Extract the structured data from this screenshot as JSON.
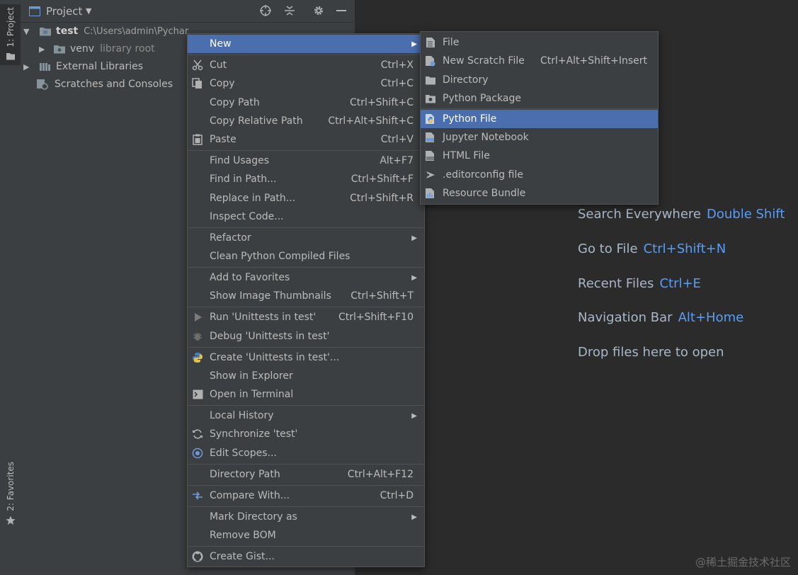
{
  "left_stripe": {
    "project_tab": "1: Project",
    "favorites_tab": "2: Favorites"
  },
  "project_panel": {
    "title": "Project",
    "tree": [
      {
        "name": "test",
        "path": "C:\\Users\\admin\\Pychar"
      },
      {
        "name": "venv",
        "tag": "library root"
      },
      {
        "name": "External Libraries"
      },
      {
        "name": "Scratches and Consoles"
      }
    ]
  },
  "editor_hints": [
    {
      "label": "Search Everywhere",
      "key": "Double Shift"
    },
    {
      "label": "Go to File",
      "key": "Ctrl+Shift+N"
    },
    {
      "label": "Recent Files",
      "key": "Ctrl+E"
    },
    {
      "label": "Navigation Bar",
      "key": "Alt+Home"
    },
    {
      "label": "Drop files here to open",
      "key": ""
    }
  ],
  "context_menu": [
    {
      "label": "New",
      "shortcut": "",
      "icon": "",
      "submenu": true,
      "selected": true
    },
    {
      "label": "Cut",
      "shortcut": "Ctrl+X",
      "icon": "scissors-icon"
    },
    {
      "label": "Copy",
      "shortcut": "Ctrl+C",
      "icon": "copy-icon"
    },
    {
      "label": "Copy Path",
      "shortcut": "Ctrl+Shift+C"
    },
    {
      "label": "Copy Relative Path",
      "shortcut": "Ctrl+Alt+Shift+C"
    },
    {
      "label": "Paste",
      "shortcut": "Ctrl+V",
      "icon": "paste-icon"
    },
    {
      "label": "Find Usages",
      "shortcut": "Alt+F7"
    },
    {
      "label": "Find in Path...",
      "shortcut": "Ctrl+Shift+F"
    },
    {
      "label": "Replace in Path...",
      "shortcut": "Ctrl+Shift+R"
    },
    {
      "label": "Inspect Code..."
    },
    {
      "label": "Refactor",
      "submenu": true
    },
    {
      "label": "Clean Python Compiled Files"
    },
    {
      "label": "Add to Favorites",
      "submenu": true
    },
    {
      "label": "Show Image Thumbnails",
      "shortcut": "Ctrl+Shift+T"
    },
    {
      "label": "Run 'Unittests in test'",
      "shortcut": "Ctrl+Shift+F10",
      "icon": "run-icon"
    },
    {
      "label": "Debug 'Unittests in test'",
      "icon": "debug-icon"
    },
    {
      "label": "Create 'Unittests in test'...",
      "icon": "python-icon"
    },
    {
      "label": "Show in Explorer"
    },
    {
      "label": "Open in Terminal",
      "icon": "terminal-icon"
    },
    {
      "label": "Local History",
      "submenu": true
    },
    {
      "label": "Synchronize 'test'",
      "icon": "sync-icon"
    },
    {
      "label": "Edit Scopes...",
      "icon": "scope-icon"
    },
    {
      "label": "Directory Path",
      "shortcut": "Ctrl+Alt+F12"
    },
    {
      "label": "Compare With...",
      "shortcut": "Ctrl+D",
      "icon": "compare-icon"
    },
    {
      "label": "Mark Directory as",
      "submenu": true
    },
    {
      "label": "Remove BOM"
    },
    {
      "label": "Create Gist...",
      "icon": "github-icon"
    }
  ],
  "new_submenu": [
    {
      "label": "File",
      "shortcut": "",
      "icon": "file-icon"
    },
    {
      "label": "New Scratch File",
      "shortcut": "Ctrl+Alt+Shift+Insert",
      "icon": "scratch-file-icon"
    },
    {
      "label": "Directory",
      "icon": "folder-icon"
    },
    {
      "label": "Python Package",
      "icon": "package-icon"
    },
    {
      "label": "Python File",
      "icon": "python-file-icon",
      "selected": true
    },
    {
      "label": "Jupyter Notebook",
      "icon": "jupyter-icon"
    },
    {
      "label": "HTML File",
      "icon": "html-icon"
    },
    {
      "label": ".editorconfig file",
      "icon": "editorconfig-icon"
    },
    {
      "label": "Resource Bundle",
      "icon": "resource-bundle-icon"
    }
  ],
  "watermark": "@稀土掘金技术社区",
  "colors": {
    "selection": "#4b6eaf",
    "panel": "#3c3f41",
    "editor": "#2b2b2b",
    "hint_key": "#589df6"
  }
}
